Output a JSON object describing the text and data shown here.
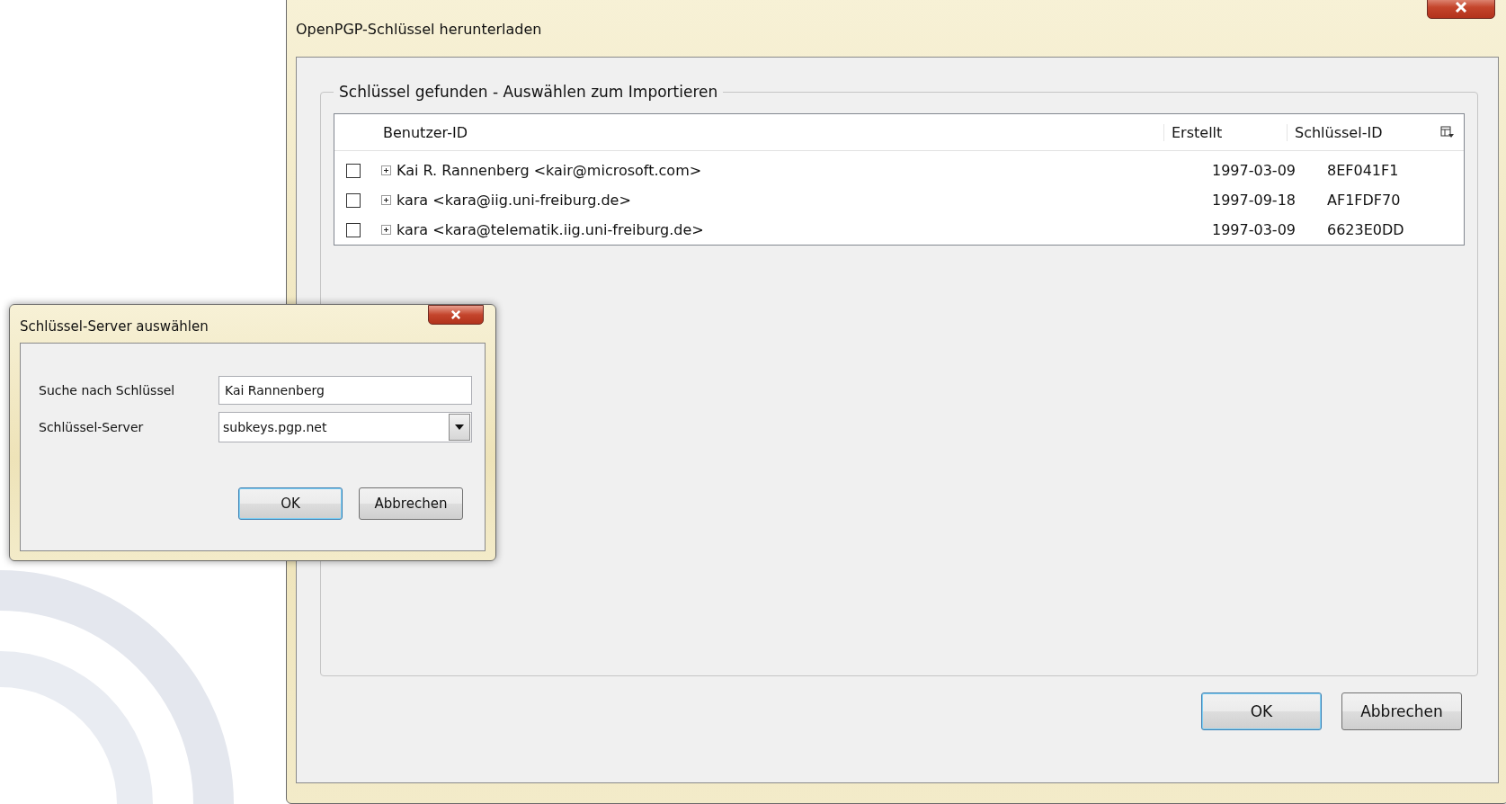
{
  "main_window": {
    "title": "OpenPGP-Schlüssel herunterladen",
    "group_label": "Schlüssel gefunden - Auswählen zum Importieren",
    "table": {
      "columns": [
        "Benutzer-ID",
        "Erstellt",
        "Schlüssel-ID"
      ],
      "rows": [
        {
          "checked": false,
          "expanded": false,
          "user_id": "Kai R. Rannenberg <kair@microsoft.com>",
          "created": "1997-03-09",
          "key_id": "8EF041F1"
        },
        {
          "checked": false,
          "expanded": false,
          "user_id": "kara <kara@iig.uni-freiburg.de>",
          "created": "1997-09-18",
          "key_id": "AF1FDF70"
        },
        {
          "checked": false,
          "expanded": false,
          "user_id": "kara <kara@telematik.iig.uni-freiburg.de>",
          "created": "1997-03-09",
          "key_id": "6623E0DD"
        }
      ]
    },
    "buttons": [
      {
        "label": "OK",
        "default": true
      },
      {
        "label": "Abbrechen",
        "default": false
      }
    ]
  },
  "search_dialog": {
    "title": "Schlüssel-Server auswählen",
    "search_label": "Suche nach Schlüssel",
    "search_value": "Kai Rannenberg",
    "server_label": "Schlüssel-Server",
    "server_value": "subkeys.pgp.net",
    "buttons": [
      {
        "label": "OK",
        "default": true
      },
      {
        "label": "Abbrechen",
        "default": false
      }
    ]
  }
}
